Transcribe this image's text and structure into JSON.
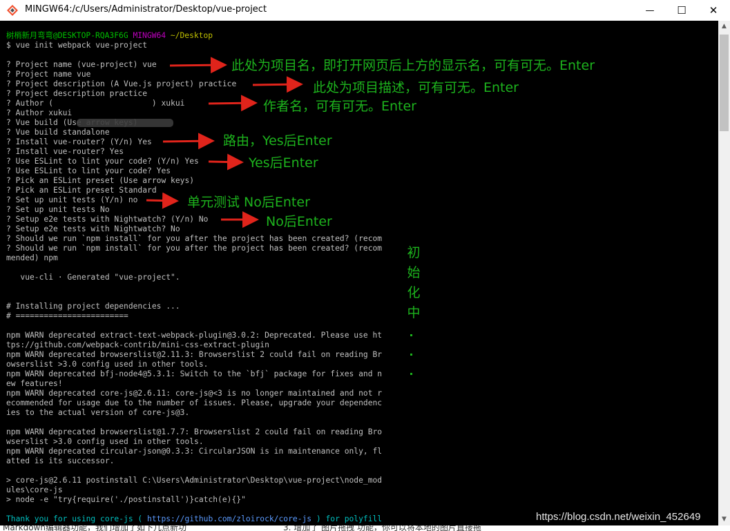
{
  "window": {
    "title": "MINGW64:/c/Users/Administrator/Desktop/vue-project",
    "minimize_glyph": "—",
    "maximize_glyph": "☐",
    "close_glyph": "✕"
  },
  "prompt": {
    "user": "树梢新月弯弯",
    "host": "@DESKTOP-RQA3F6G",
    "shell": "MINGW64",
    "path": "~/Desktop"
  },
  "lines": [
    {
      "t": "$ vue init webpack vue-project"
    },
    {
      "t": ""
    },
    {
      "t": "? Project name (vue-project) vue"
    },
    {
      "t": "? Project name vue"
    },
    {
      "t": "? Project description (A Vue.js project) practice"
    },
    {
      "t": "? Project description practice"
    },
    {
      "t": "? Author (                     ) xukui"
    },
    {
      "t": "? Author xukui"
    },
    {
      "t": "? Vue build (Use arrow keys)"
    },
    {
      "t": "? Vue build standalone"
    },
    {
      "t": "? Install vue-router? (Y/n) Yes"
    },
    {
      "t": "? Install vue-router? Yes"
    },
    {
      "t": "? Use ESLint to lint your code? (Y/n) Yes"
    },
    {
      "t": "? Use ESLint to lint your code? Yes"
    },
    {
      "t": "? Pick an ESLint preset (Use arrow keys)"
    },
    {
      "t": "? Pick an ESLint preset Standard"
    },
    {
      "t": "? Set up unit tests (Y/n) no"
    },
    {
      "t": "? Set up unit tests No"
    },
    {
      "t": "? Setup e2e tests with Nightwatch? (Y/n) No"
    },
    {
      "t": "? Setup e2e tests with Nightwatch? No"
    },
    {
      "t": "? Should we run `npm install` for you after the project has been created? (recom"
    },
    {
      "t": "? Should we run `npm install` for you after the project has been created? (recom"
    },
    {
      "t": "mended) npm"
    },
    {
      "t": ""
    },
    {
      "t": "   vue-cli · Generated \"vue-project\"."
    },
    {
      "t": ""
    },
    {
      "t": ""
    },
    {
      "t": "# Installing project dependencies ..."
    },
    {
      "t": "# ========================"
    },
    {
      "t": ""
    },
    {
      "t": "npm WARN deprecated extract-text-webpack-plugin@3.0.2: Deprecated. Please use ht"
    },
    {
      "t": "tps://github.com/webpack-contrib/mini-css-extract-plugin"
    },
    {
      "t": "npm WARN deprecated browserslist@2.11.3: Browserslist 2 could fail on reading Br"
    },
    {
      "t": "owserslist >3.0 config used in other tools."
    },
    {
      "t": "npm WARN deprecated bfj-node4@5.3.1: Switch to the `bfj` package for fixes and n"
    },
    {
      "t": "ew features!"
    },
    {
      "t": "npm WARN deprecated core-js@2.6.11: core-js@<3 is no longer maintained and not r"
    },
    {
      "t": "ecommended for usage due to the number of issues. Please, upgrade your dependenc"
    },
    {
      "t": "ies to the actual version of core-js@3."
    },
    {
      "t": ""
    },
    {
      "t": "npm WARN deprecated browserslist@1.7.7: Browserslist 2 could fail on reading Bro"
    },
    {
      "t": "wserslist >3.0 config used in other tools."
    },
    {
      "t": "npm WARN deprecated circular-json@0.3.3: CircularJSON is in maintenance only, fl"
    },
    {
      "t": "atted is its successor."
    },
    {
      "t": ""
    },
    {
      "t": "> core-js@2.6.11 postinstall C:\\Users\\Administrator\\Desktop\\vue-project\\node_mod"
    },
    {
      "t": "ules\\core-js"
    },
    {
      "t": "> node -e \"try{require('./postinstall')}catch(e){}\""
    }
  ],
  "thanks_line": {
    "prefix": "Thank you for using core-js ( ",
    "url": "https://github.com/zloirock/core-js",
    "suffix": " ) for polyfill"
  },
  "annotations": {
    "project_name": "此处为项目名，即打开网页后上方的显示名，可有可无。Enter",
    "project_description": "此处为项目描述，可有可无。Enter",
    "author": "作者名，可有可无。Enter",
    "router": "路由，Yes后Enter",
    "eslint": "Yes后Enter",
    "unit_tests": "单元测试 No后Enter",
    "e2e": "No后Enter",
    "initializing": [
      "初",
      "始",
      "化",
      "中"
    ]
  },
  "watermark": "https://blog.csdn.net/weixin_452649",
  "bottom_strip": {
    "left": "Markdown编辑器功能，我们增加了如下几点新功",
    "right": "3. 增加了 图片拖拽 功能，你可以将本地的图片直接拖"
  },
  "scrollbar": {
    "up_glyph": "▲",
    "down_glyph": "▼"
  },
  "colors": {
    "terminal_bg": "#000000",
    "terminal_fg": "#c0c0c0",
    "prompt_user": "#00c000",
    "prompt_shell": "#c000c0",
    "prompt_path": "#c0c000",
    "annotation": "#1db31d",
    "arrow": "#e0241b",
    "thanks": "#00c0c0",
    "thanks_url": "#5b9bff"
  }
}
